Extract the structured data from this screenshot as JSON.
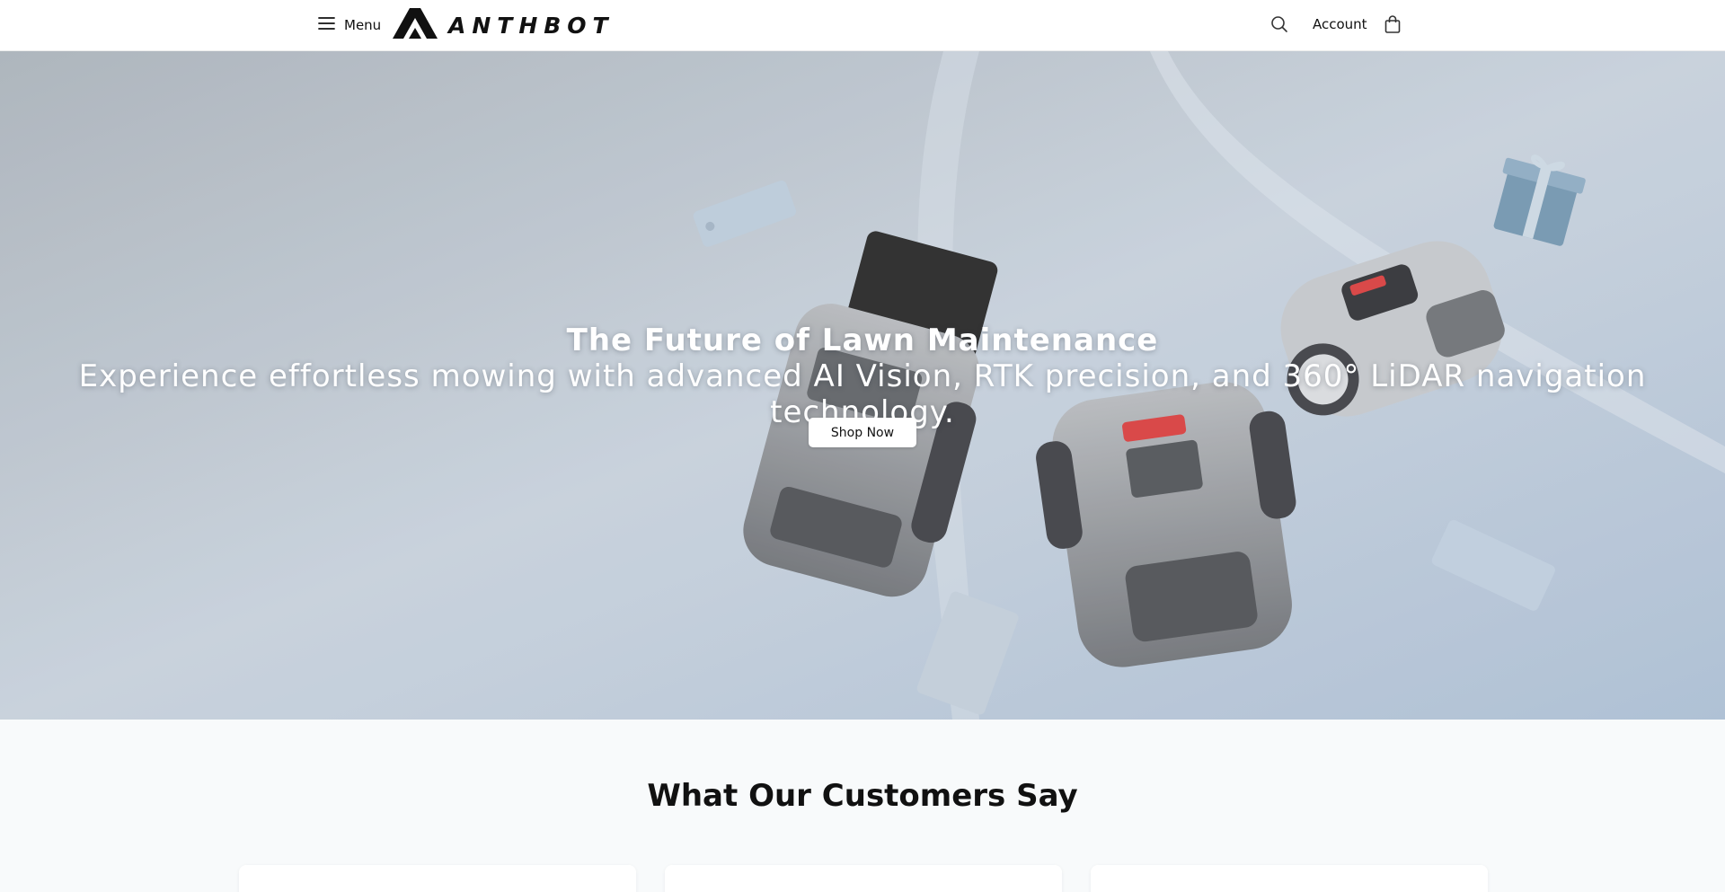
{
  "header": {
    "menu_label": "Menu",
    "brand": "ANTHBOT",
    "account_label": "Account",
    "icons": {
      "menu": "hamburger-icon",
      "search": "search-icon",
      "cart": "shopping-bag-icon",
      "logo": "anthbot-logo-icon"
    }
  },
  "hero": {
    "title": "The Future of Lawn Maintenance",
    "subtitle": "Experience effortless mowing with advanced AI Vision, RTK precision, and 360° LiDAR navigation technology.",
    "cta_label": "Shop Now"
  },
  "reviews": {
    "title": "What Our Customers Say",
    "cards": [
      {},
      {},
      {}
    ]
  },
  "colors": {
    "accent": "#111111",
    "hero_bg": "#bcc8d5",
    "mower_body": "#8e9297",
    "mower_button": "#d63a3a"
  }
}
